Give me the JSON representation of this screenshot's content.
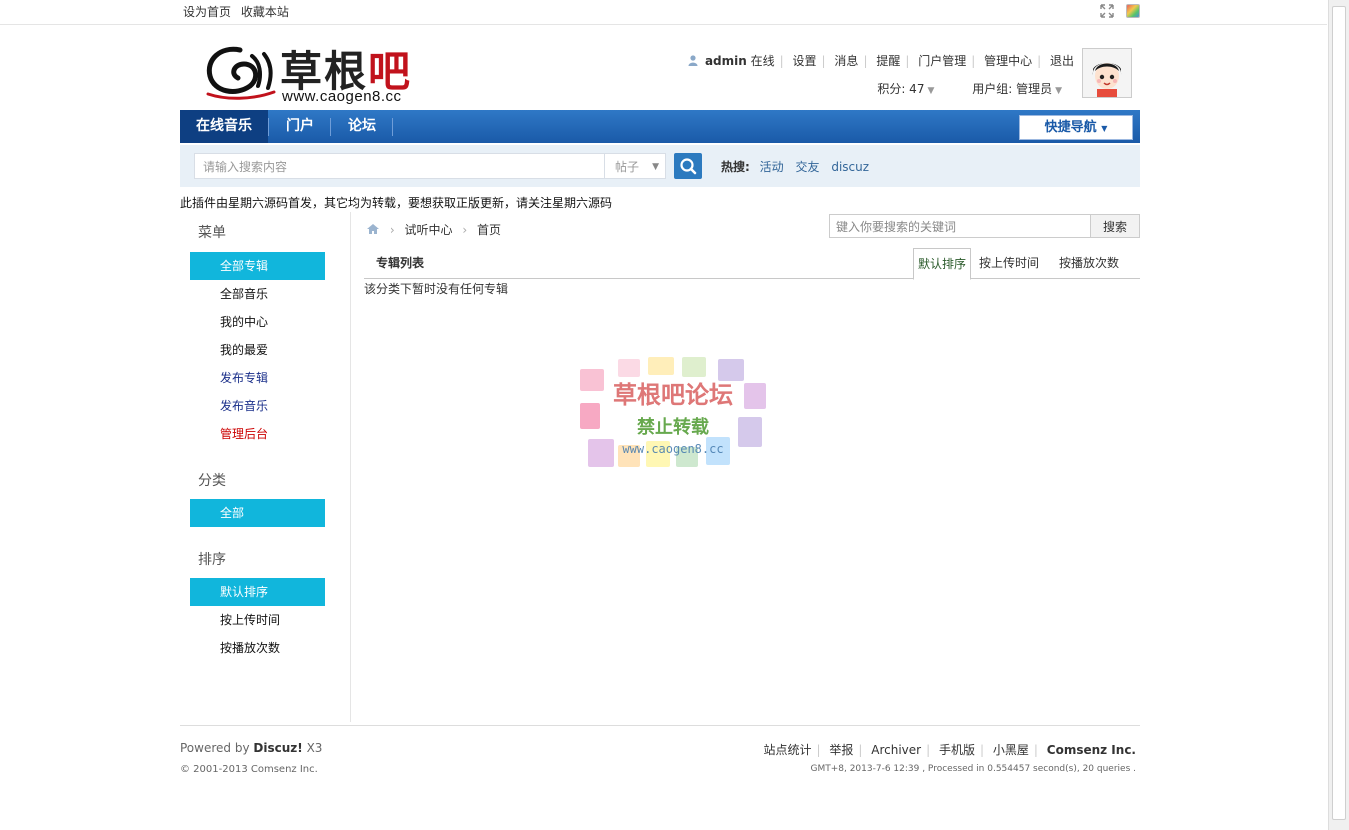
{
  "topbar": {
    "set_home": "设为首页",
    "bookmark": "收藏本站"
  },
  "logo": {
    "name_black": "草根",
    "name_red": "吧",
    "url": "www.caogen8.cc"
  },
  "user": {
    "name": "admin",
    "status": "在线",
    "links": [
      "设置",
      "消息",
      "提醒",
      "门户管理",
      "管理中心",
      "退出"
    ],
    "points": "积分: 47",
    "group": "用户组: 管理员"
  },
  "nav": {
    "items": [
      "在线音乐",
      "门户",
      "论坛"
    ],
    "quick_nav": "快捷导航"
  },
  "search": {
    "placeholder": "请输入搜索内容",
    "type": "帖子",
    "hot_label": "热搜:",
    "hot_items": [
      "活动",
      "交友",
      "discuz"
    ]
  },
  "notice": "此插件由星期六源码首发，其它均为转载，要想获取正版更新，请关注星期六源码",
  "sidebar": {
    "menu_title": "菜单",
    "menu_items": [
      "全部专辑",
      "全部音乐",
      "我的中心",
      "我的最爱",
      "发布专辑",
      "发布音乐",
      "管理后台"
    ],
    "category_title": "分类",
    "category_items": [
      "全部"
    ],
    "sort_title": "排序",
    "sort_items": [
      "默认排序",
      "按上传时间",
      "按播放次数"
    ]
  },
  "content": {
    "breadcrumb": [
      "试听中心",
      "首页"
    ],
    "keyword_placeholder": "键入你要搜索的关键词",
    "keyword_button": "搜索",
    "list_title": "专辑列表",
    "tabs": [
      "默认排序",
      "按上传时间",
      "按播放次数"
    ],
    "empty_message": "该分类下暂时没有任何专辑"
  },
  "footer": {
    "powered_prefix": "Powered by",
    "powered_brand": "Discuz!",
    "powered_version": "X3",
    "copyright": "© 2001-2013 Comsenz Inc.",
    "links": [
      "站点统计",
      "举报",
      "Archiver",
      "手机版",
      "小黑屋"
    ],
    "company": "Comsenz Inc.",
    "stats": "GMT+8, 2013-7-6 12:39 , Processed in 0.554457 second(s), 20 queries ."
  },
  "watermark": {
    "title": "草根吧论坛",
    "subtitle": "禁止转载",
    "url": "www.caogen8.cc"
  },
  "colors": {
    "nav_blue": "#1a5aa8",
    "nav_active": "#0e3f82",
    "sidebar_active": "#11b6dc",
    "search_bg": "#e8f0f7",
    "logo_red": "#c1121c"
  }
}
